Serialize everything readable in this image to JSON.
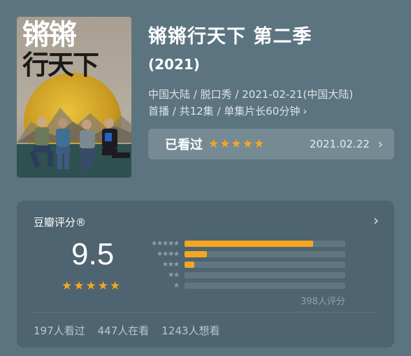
{
  "poster": {
    "title_line1": "锵锵",
    "title_line2": "行天下"
  },
  "header": {
    "title": "锵锵行天下 第二季",
    "year": "(2021)",
    "meta_line1": "中国大陆 / 脱口秀 / 2021-02-21(中国大陆)",
    "meta_line2": "首播 / 共12集 / 单集片长60分钟",
    "chevron": "›"
  },
  "watched": {
    "label": "已看过",
    "stars": "★★★★★",
    "date": "2021.02.22",
    "chevron": "›"
  },
  "rating": {
    "label": "豆瓣评分®",
    "chevron": "›",
    "score": "9.5",
    "stars": "★★★★★",
    "distribution": [
      {
        "stars": "★★★★★",
        "fraction": 0.8
      },
      {
        "stars": "★★★★",
        "fraction": 0.14
      },
      {
        "stars": "★★★",
        "fraction": 0.06
      },
      {
        "stars": "★★",
        "fraction": 0.0
      },
      {
        "stars": "★",
        "fraction": 0.0
      }
    ],
    "count": "398人评分",
    "stats": [
      "197人看过",
      "447人在看",
      "1243人想看"
    ]
  },
  "colors": {
    "accent": "#f5a623",
    "background": "#5c7480",
    "card": "#4e6470"
  }
}
